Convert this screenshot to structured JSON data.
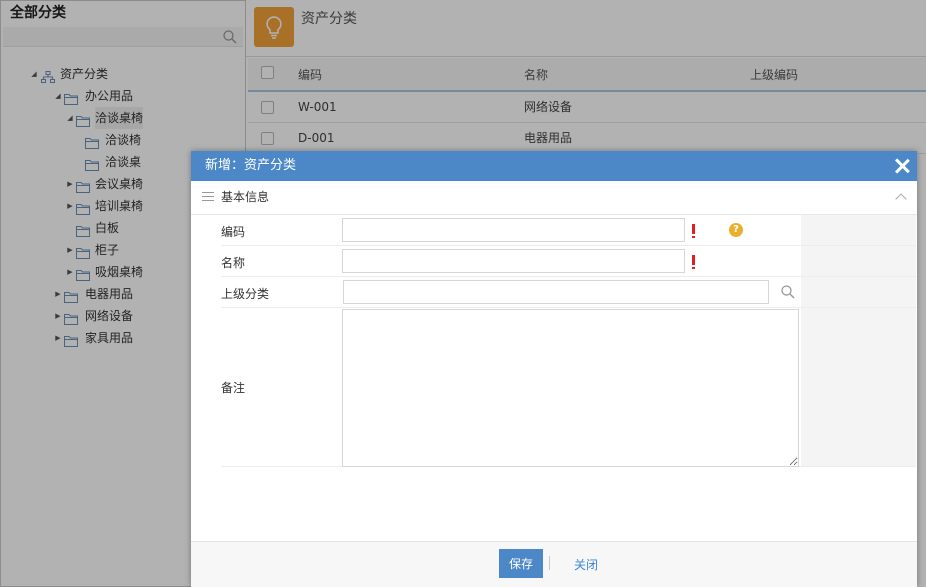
{
  "left": {
    "title": "全部分类",
    "search_placeholder": "",
    "tree": [
      {
        "label": "资产分类",
        "level": 0,
        "toggle": "expanded",
        "icon": "org-tree-icon"
      },
      {
        "label": "办公用品",
        "level": 1,
        "toggle": "expanded",
        "icon": "folder-icon"
      },
      {
        "label": "洽谈桌椅",
        "level": 2,
        "toggle": "expanded",
        "icon": "folder-icon",
        "selected": true
      },
      {
        "label": "洽谈椅",
        "level": 3,
        "toggle": "none",
        "icon": "folder-icon"
      },
      {
        "label": "洽谈桌",
        "level": 3,
        "toggle": "none",
        "icon": "folder-icon"
      },
      {
        "label": "会议桌椅",
        "level": 2,
        "toggle": "collapsed",
        "icon": "folder-icon"
      },
      {
        "label": "培训桌椅",
        "level": 2,
        "toggle": "collapsed",
        "icon": "folder-icon"
      },
      {
        "label": "白板",
        "level": 2,
        "toggle": "none",
        "icon": "folder-icon"
      },
      {
        "label": "柜子",
        "level": 2,
        "toggle": "collapsed",
        "icon": "folder-icon"
      },
      {
        "label": "吸烟桌椅",
        "level": 2,
        "toggle": "collapsed",
        "icon": "folder-icon"
      },
      {
        "label": "电器用品",
        "level": 1,
        "toggle": "collapsed",
        "icon": "folder-icon"
      },
      {
        "label": "网络设备",
        "level": 1,
        "toggle": "collapsed",
        "icon": "folder-icon"
      },
      {
        "label": "家具用品",
        "level": 1,
        "toggle": "collapsed",
        "icon": "folder-icon"
      }
    ]
  },
  "right": {
    "title": "资产分类",
    "icon": "lightbulb-icon",
    "columns": [
      "编码",
      "名称",
      "上级编码"
    ],
    "rows": [
      {
        "code": "W-001",
        "name": "网络设备",
        "parent": ""
      },
      {
        "code": "D-001",
        "name": "电器用品",
        "parent": ""
      }
    ]
  },
  "dialog": {
    "title": "新增：资产分类",
    "section": "基本信息",
    "fields": {
      "code": {
        "label": "编码",
        "value": ""
      },
      "name": {
        "label": "名称",
        "value": ""
      },
      "parent": {
        "label": "上级分类",
        "value": ""
      },
      "remark": {
        "label": "备注",
        "value": ""
      }
    },
    "help_glyph": "?",
    "save_label": "保存",
    "close_label": "关闭"
  },
  "colors": {
    "accent": "#4c87c7",
    "header_icon_bg": "#f2a33a",
    "required": "#e02020",
    "help": "#e8b02c",
    "link": "#3a86d5"
  }
}
